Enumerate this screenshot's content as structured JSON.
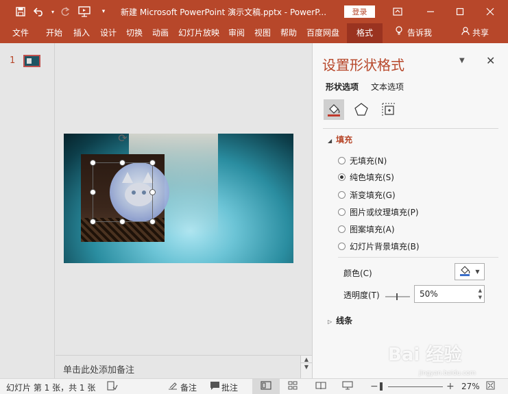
{
  "window": {
    "title": "新建 Microsoft PowerPoint 演示文稿.pptx  -  PowerP...",
    "login_label": "登录",
    "accent_color": "#b7472a"
  },
  "quick_access": {
    "icons": [
      "save-icon",
      "undo-icon",
      "redo-icon",
      "present-icon",
      "customize-icon"
    ]
  },
  "ribbon": {
    "tabs": [
      "文件",
      "开始",
      "插入",
      "设计",
      "切换",
      "动画",
      "幻灯片放映",
      "审阅",
      "视图",
      "帮助",
      "百度网盘",
      "格式"
    ],
    "active_tab": "格式",
    "tell_me": "告诉我",
    "share": "共享"
  },
  "thumbnails": {
    "slide_number": "1"
  },
  "notes": {
    "placeholder": "单击此处添加备注"
  },
  "format_pane": {
    "title": "设置形状格式",
    "tabs": [
      "形状选项",
      "文本选项"
    ],
    "active_tab": "形状选项",
    "icons": [
      "fill-line-icon",
      "effects-icon",
      "size-properties-icon"
    ],
    "fill_section": "填充",
    "fill_options": [
      "无填充(N)",
      "纯色填充(S)",
      "渐变填充(G)",
      "图片或纹理填充(P)",
      "图案填充(A)",
      "幻灯片背景填充(B)"
    ],
    "selected_fill": "纯色填充(S)",
    "color_label": "颜色(C)",
    "transparency_label": "透明度(T)",
    "transparency_value": "50%",
    "line_section": "线条"
  },
  "status_bar": {
    "slide_info": "幻灯片 第 1 张，共 1 张",
    "notes_label": "备注",
    "comments_label": "批注",
    "zoom_level": "27%"
  },
  "watermark": {
    "brand": "Bai 经验",
    "url": "jingyan.baidu.com"
  }
}
